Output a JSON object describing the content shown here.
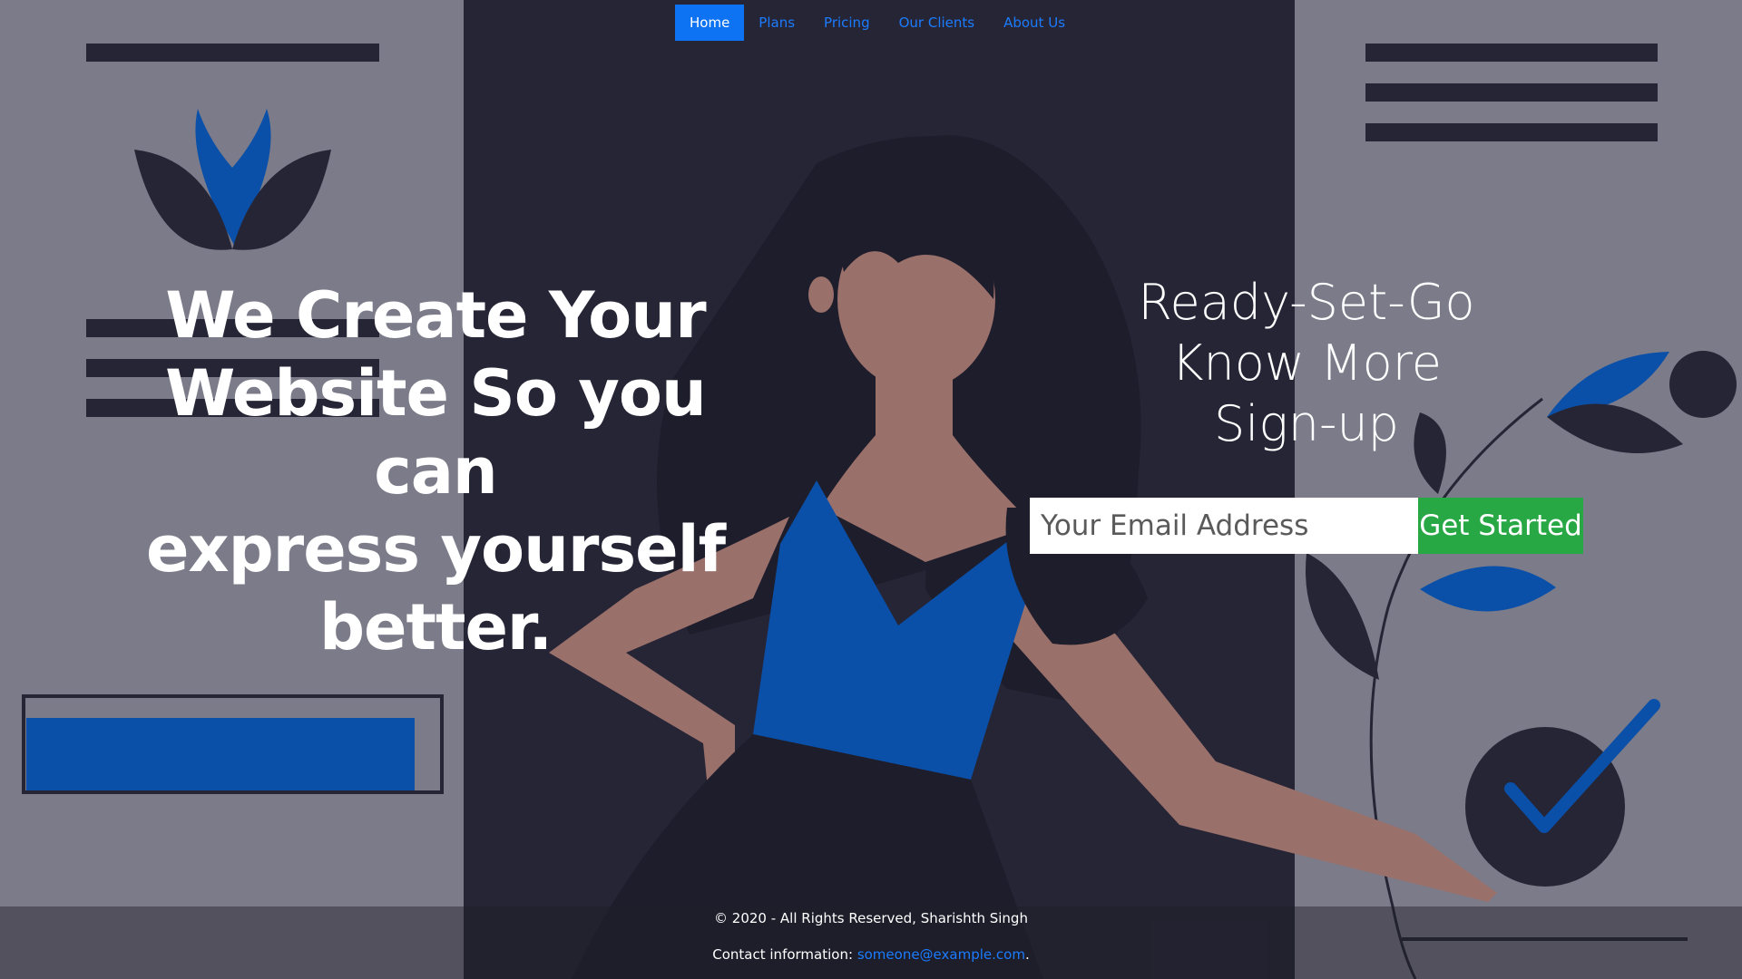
{
  "nav": {
    "items": [
      {
        "label": "Home",
        "active": true
      },
      {
        "label": "Plans",
        "active": false
      },
      {
        "label": "Pricing",
        "active": false
      },
      {
        "label": "Our Clients",
        "active": false
      },
      {
        "label": "About Us",
        "active": false
      }
    ]
  },
  "hero": {
    "lines": [
      "We Create Your",
      "Website So you",
      "can",
      "express yourself",
      "better."
    ]
  },
  "cta": {
    "lines": [
      "Ready-Set-Go",
      "Know More",
      "Sign-up"
    ],
    "email_placeholder": "Your Email Address",
    "button_label": "Get Started"
  },
  "footer": {
    "copyright": "© 2020 - All Rights Reserved, Sharishth Singh",
    "contact_label": "Contact information:",
    "contact_email": "someone@example.com",
    "contact_suffix": "."
  },
  "colors": {
    "side_panel": "#7c7b89",
    "center_panel": "#262536",
    "accent_blue": "#0a50a8",
    "link_blue": "#1b7cff",
    "button_green": "#28a745",
    "skin": "#9a706b"
  }
}
